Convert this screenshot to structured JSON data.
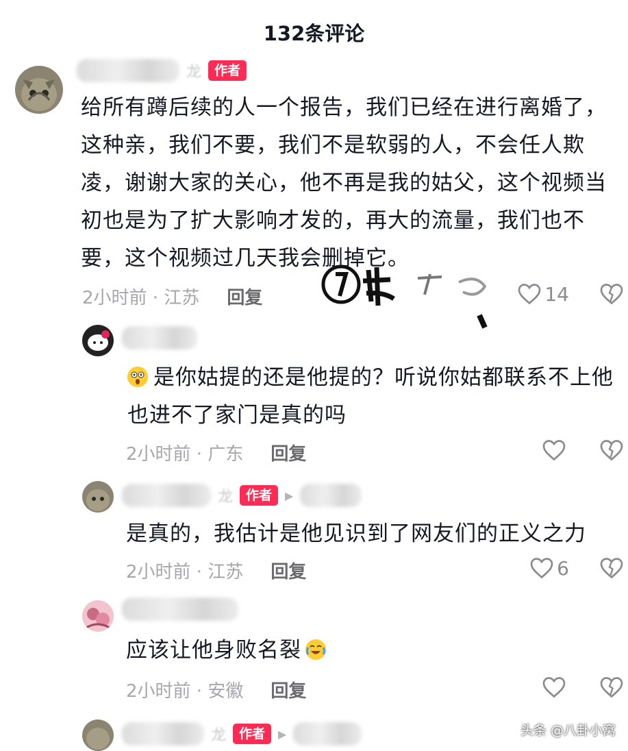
{
  "header": {
    "title": "132条评论"
  },
  "comments": [
    {
      "name_tail": "龙",
      "tag": "作者",
      "text": "给所有蹲后续的人一个报告，我们已经在进行离婚了，这种亲，我们不要，我们不是软弱的人，不会任人欺凌，谢谢大家的关心，他不再是我的姑父，这个视频当初也是为了扩大影响才发的，再大的流量，我们也不要，这个视频过几天我会删掉它。",
      "time": "2小时前 · 江苏",
      "reply": "回复",
      "likes": "14",
      "avatar": "cat-avatar"
    },
    {
      "text": "是你姑提的还是他提的？听说你姑都联系不上他 也进不了家门是真的吗",
      "time": "2小时前 · 广东",
      "reply": "回复",
      "likes": "",
      "avatar": "kitty-avatar"
    },
    {
      "name_tail": "龙",
      "tag": "作者",
      "text": "是真的，我估计是他见识到了网友们的正义之力",
      "time": "2小时前 · 江苏",
      "reply": "回复",
      "likes": "6",
      "avatar": "cat-avatar"
    },
    {
      "text": "应该让他身败名裂",
      "time": "2小时前 · 安徽",
      "reply": "回复",
      "likes": "",
      "avatar": "pink-avatar"
    },
    {
      "name_tail": "龙",
      "tag": "作者",
      "avatar": "cat-avatar"
    }
  ],
  "watermark": "头条 @八卦小窝",
  "icons": {
    "like": "heart-outline-icon",
    "dislike": "broken-heart-icon"
  }
}
